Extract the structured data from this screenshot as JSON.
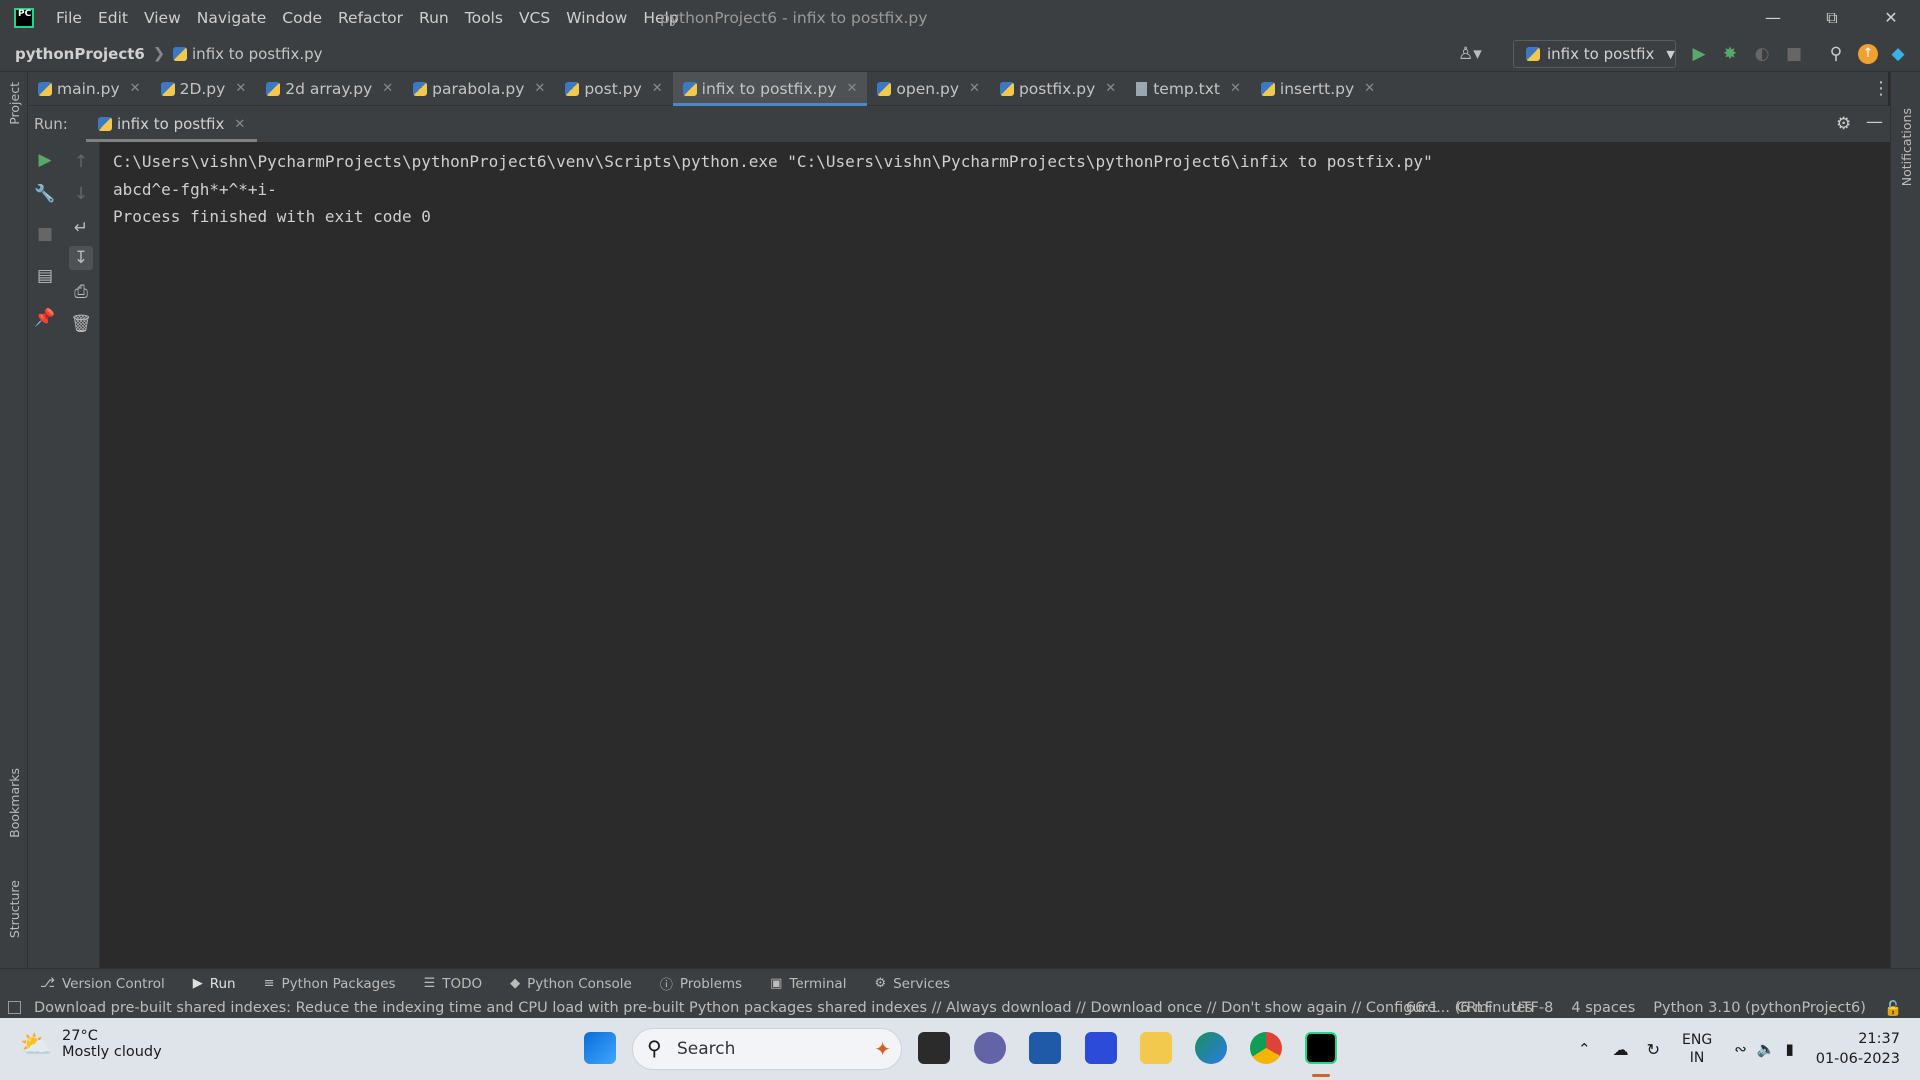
{
  "menu": [
    "File",
    "Edit",
    "View",
    "Navigate",
    "Code",
    "Refactor",
    "Run",
    "Tools",
    "VCS",
    "Window",
    "Help"
  ],
  "window_title": "pythonProject6 - infix to postfix.py",
  "breadcrumb": {
    "project": "pythonProject6",
    "file": "infix to postfix.py"
  },
  "run_config": "infix to postfix",
  "tabs": [
    {
      "label": "main.py",
      "type": "py"
    },
    {
      "label": "2D.py",
      "type": "py"
    },
    {
      "label": "2d array.py",
      "type": "py"
    },
    {
      "label": "parabola.py",
      "type": "py"
    },
    {
      "label": "post.py",
      "type": "py"
    },
    {
      "label": "infix to postfix.py",
      "type": "py",
      "active": true
    },
    {
      "label": "open.py",
      "type": "py"
    },
    {
      "label": "postfix.py",
      "type": "py"
    },
    {
      "label": "temp.txt",
      "type": "txt"
    },
    {
      "label": "insertt.py",
      "type": "py"
    }
  ],
  "left_stripe": {
    "project": "Project",
    "bookmarks": "Bookmarks",
    "structure": "Structure"
  },
  "right_stripe": {
    "notifications": "Notifications"
  },
  "run_panel": {
    "label": "Run:",
    "tab": "infix to postfix"
  },
  "console_lines": [
    "C:\\Users\\vishn\\PycharmProjects\\pythonProject6\\venv\\Scripts\\python.exe \"C:\\Users\\vishn\\PycharmProjects\\pythonProject6\\infix to postfix.py\"",
    "abcd^e-fgh*+^*+i-",
    "Process finished with exit code 0"
  ],
  "bottom_tools": [
    {
      "label": "Version Control",
      "icon": "branch-icon"
    },
    {
      "label": "Run",
      "icon": "play-icon",
      "active": true
    },
    {
      "label": "Python Packages",
      "icon": "layers-icon"
    },
    {
      "label": "TODO",
      "icon": "list-icon"
    },
    {
      "label": "Python Console",
      "icon": "python-icon"
    },
    {
      "label": "Problems",
      "icon": "warning-icon"
    },
    {
      "label": "Terminal",
      "icon": "terminal-icon"
    },
    {
      "label": "Services",
      "icon": "services-icon"
    }
  ],
  "status": {
    "message": "Download pre-built shared indexes: Reduce the indexing time and CPU load with pre-built Python packages shared indexes // Always download // Download once // Don't show again // Configure... (6 minutes",
    "position": "66:1",
    "line_sep": "CRLF",
    "encoding": "UTF-8",
    "indent": "4 spaces",
    "interpreter": "Python 3.10 (pythonProject6)"
  },
  "taskbar": {
    "weather_temp": "27°C",
    "weather_cond": "Mostly cloudy",
    "search": "Search",
    "lang1": "ENG",
    "lang2": "IN",
    "time": "21:37",
    "date": "01-06-2023"
  },
  "colors": {
    "accent": "#4a88c7",
    "run_green": "#59a869",
    "bg": "#2b2b2b",
    "panel": "#3c3f41"
  }
}
